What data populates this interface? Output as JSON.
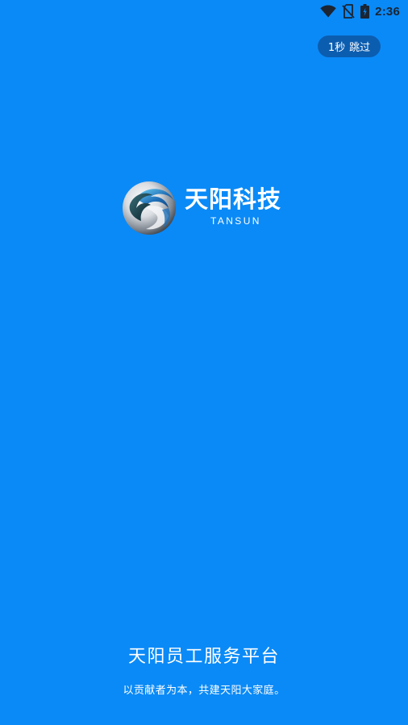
{
  "status_bar": {
    "time": "2:36",
    "icons": [
      "wifi-icon",
      "no-sim-icon",
      "battery-icon"
    ]
  },
  "skip": {
    "countdown": "1秒",
    "label": "跳过"
  },
  "logo": {
    "name_cn": "天阳科技",
    "name_en": "TANSUN"
  },
  "footer": {
    "title": "天阳员工服务平台",
    "slogan": "以贡献者为本，共建天阳大家庭。"
  },
  "colors": {
    "background": "#0A8AF7",
    "skip_button": "#0B5DB0",
    "status_icons": "#1b2533",
    "text": "#ffffff"
  }
}
